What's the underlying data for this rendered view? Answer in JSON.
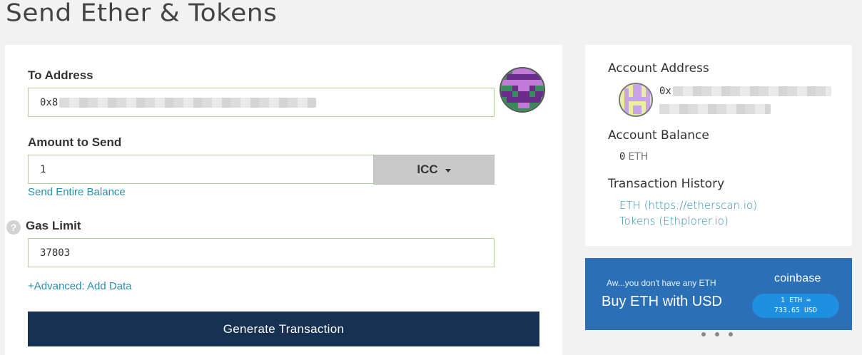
{
  "page_title": "Send Ether & Tokens",
  "form": {
    "to_address_label": "To Address",
    "to_address_value": "0x8",
    "amount_label": "Amount to Send",
    "amount_value": "1",
    "unit_selected": "ICC",
    "send_entire_balance": "Send Entire Balance",
    "gas_limit_label": "Gas Limit",
    "gas_limit_value": "37803",
    "help_glyph": "?",
    "advanced_link": "+Advanced: Add Data",
    "generate_button": "Generate Transaction"
  },
  "account": {
    "address_label": "Account Address",
    "address_value": "0x",
    "balance_label": "Account Balance",
    "balance_value": "0",
    "balance_unit": "ETH",
    "history_label": "Transaction History",
    "history_links": [
      "ETH (https://etherscan.io)",
      "Tokens (Ethplorer.io)"
    ]
  },
  "coinbase": {
    "subtitle": "Aw...you don't have any ETH",
    "title": "Buy ETH with USD",
    "brand": "coinbase",
    "rate_line1": "1 ETH ≈",
    "rate_line2": "733.65 USD"
  },
  "icons": {
    "recipient_identicon": "identicon-icon",
    "account_identicon": "identicon-icon",
    "help": "question-icon",
    "dropdown": "chevron-down-icon"
  },
  "colors": {
    "input_border": "#a7d88f",
    "button_bg": "#163151",
    "link": "#2a8eb0",
    "coinbase_bg": "#2b6fb6"
  }
}
